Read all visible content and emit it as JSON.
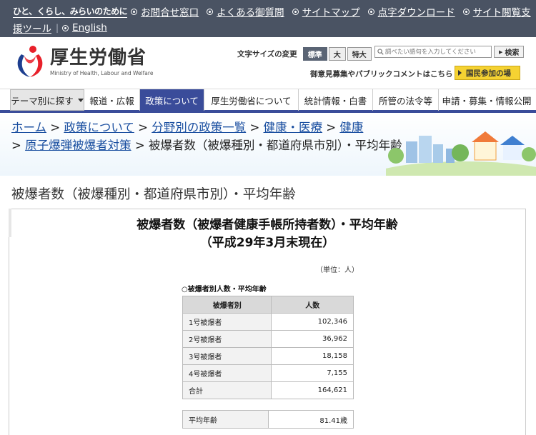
{
  "topbar": {
    "tagline": "ひと、くらし、みらいのために",
    "links": [
      "お問合せ窓口",
      "よくある御質問",
      "サイトマップ",
      "点字ダウンロード",
      "サイト閲覧支",
      "援ツール",
      "English"
    ]
  },
  "header": {
    "logo_jp": "厚生労働省",
    "logo_en": "Ministry of Health, Labour and Welfare",
    "fontsize_label": "文字サイズの変更",
    "fontsize_options": [
      "標準",
      "大",
      "特大"
    ],
    "search_placeholder": "調べたい語句を入力してください",
    "search_button": "検索",
    "public_comment": "御意見募集やパブリックコメントはこちら",
    "kokumin": "国民参加の場"
  },
  "nav": {
    "items": [
      "テーマ別に探す",
      "報道・広報",
      "政策について",
      "厚生労働省について",
      "統計情報・白書",
      "所管の法令等",
      "申請・募集・情報公開"
    ]
  },
  "breadcrumb": {
    "links": [
      "ホーム",
      "政策について",
      "分野別の政策一覧",
      "健康・医療",
      "健康",
      "原子爆弾被爆者対策"
    ],
    "current": "被爆者数（被爆種別・都道府県市別）・平均年齢",
    "separator": ">"
  },
  "page_title": "被爆者数（被爆種別・都道府県市別）・平均年齢",
  "document": {
    "title_line1": "被爆者数（被爆者健康手帳所持者数）・平均年齢",
    "title_line2": "（平成29年3月末現在）",
    "unit": "（単位：人）",
    "section_label": "○被爆者別人数・平均年齢",
    "table": {
      "headers": [
        "被爆者別",
        "人数"
      ],
      "rows": [
        [
          "1号被爆者",
          "102,346"
        ],
        [
          "2号被爆者",
          "36,962"
        ],
        [
          "3号被爆者",
          "18,158"
        ],
        [
          "4号被爆者",
          "7,155"
        ],
        [
          "合計",
          "164,621"
        ]
      ]
    },
    "average_age": {
      "label": "平均年齢",
      "value": "81.41歳"
    }
  },
  "colors": {
    "topbar": "#4a5363",
    "nav_active": "#3a4c9a",
    "link": "#1a4fa0",
    "kokumin": "#f5d232"
  }
}
